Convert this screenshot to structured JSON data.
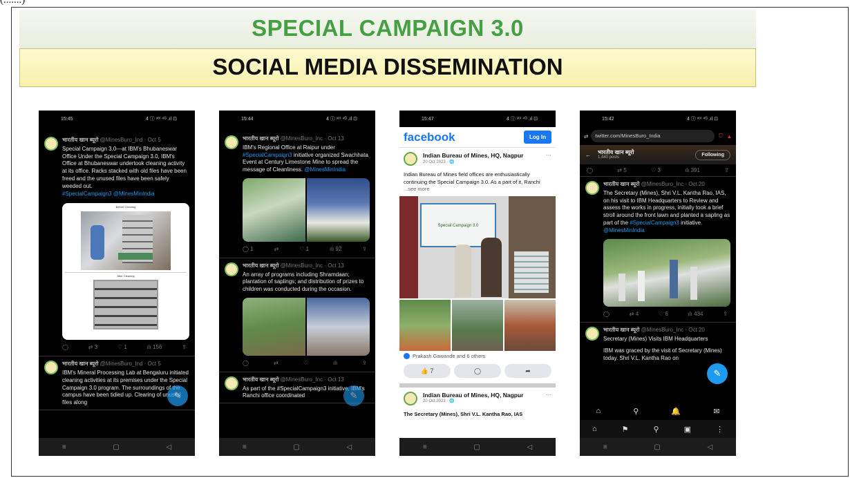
{
  "caption": "(.......)",
  "title": "SPECIAL CAMPAIGN 3.0",
  "subtitle": "SOCIAL MEDIA DISSEMINATION",
  "phone1": {
    "time": "15:45",
    "signal": "4 ⓘ ᵛᵒ⁾ ⁴ᴳ .ıl ⊡",
    "tweet1": {
      "author": "भारतीय खान ब्यूरो",
      "meta": "@MinesBuro_Ind · Oct 5",
      "text": "Special Campaign 3.0—at IBM's Bhubaneswar Office Under the Special Campaign 3.0, IBM's Office at Bhubaneswar undertook cleaning activity at its office. Racks stacked with old files have been freed and the unused files have been safely weeded out.",
      "tags": "#SpecialCampaign3 @MinesMinIndia",
      "img_label_top": "Before Cleaning",
      "img_label_bottom": "After Cleaning",
      "actions": [
        "◯",
        "⇄ 3",
        "♡ 1",
        "ılı 156",
        "⇪"
      ]
    },
    "tweet2": {
      "author": "भारतीय खान ब्यूरो",
      "meta": "@MinesBuro_Ind · Oct 5",
      "text": "IBM's Mineral Processing Lab at Bengaluru initiated cleaning activities at its premises under the Special Campaign 3.0 program. The surroundings of the campus have been tidied up. Clearing of unused files along"
    }
  },
  "phone2": {
    "time": "15:44",
    "tweet1": {
      "author": "भारतीय खान ब्यूरो",
      "meta": "@MinesBuro_Inc · Oct 13",
      "text": "IBM's Regional Office at Raipur under",
      "tag1": "#SpecialCampaign3",
      "text2": "initiative organized Swachhata Event at Century Limestone Mine to spread the message of Cleanliness.",
      "tag2": "@MinesMinIndia",
      "actions": [
        "◯ 1",
        "⇄",
        "♡ 1",
        "ılı 92",
        "⇪"
      ]
    },
    "tweet2": {
      "author": "भारतीय खान ब्यूरो",
      "meta": "@MinesBuro_Inc · Oct 13",
      "text": "An array of programs including Shramdaan; plantation of saplings; and distribution of prizes to children was conducted during the occasion.",
      "actions": [
        "◯",
        "⇄",
        "♡",
        "ılı",
        "⇪"
      ]
    },
    "tweet3": {
      "author": "भारतीय खान ब्यूरो",
      "meta": "@MinesBuro_Inc · Oct 13",
      "text": "As part of the #SpecialCampaign3 initiative, IBM's Ranchi office coordinated"
    }
  },
  "phone3": {
    "time": "15:47",
    "logo": "facebook",
    "login": "Log In",
    "post1": {
      "name": "Indian Bureau of Mines, HQ, Nagpur",
      "date": "20 Oct 2023 · 🌐",
      "text": "Indian Bureau of Mines field offices are enthusiastically continuing the Special Campaign 3.0. As a part of it, Ranchi",
      "more": "...see more",
      "banner": "Special Campaign 3.0",
      "reactions": "Prakash Gawande and 6 others",
      "like_count": "7"
    },
    "post2": {
      "name": "Indian Bureau of Mines, HQ, Nagpur",
      "date": "20 Oct 2023 · 🌐",
      "text": "The Secretary (Mines), Shri V.L. Kantha Rao, IAS"
    }
  },
  "phone4": {
    "time": "15:42",
    "url": "twitter.com/MinesBuro_India",
    "profile_name": "भारतीय खान ब्यूरो",
    "profile_sub": "1,440 posts",
    "following": "Following",
    "tweet1": {
      "author": "भारतीय खान ब्यूरो",
      "meta": "@MinesBuro_Inc · Oct 20",
      "text": "The Secretary (Mines), Shri V.L. Kantha Rao, IAS, on his visit to IBM Headquarters to Review and assess the works in progress, initially took a brief stroll around the front lawn and planted a sapling as part of the",
      "tag1": "#SpecialCampaign3",
      "text2": "initiative.",
      "tag2": "@MinesMinIndia",
      "actions": [
        "◯",
        "⇄ 4",
        "♡ 6",
        "ılı 434",
        "⇪"
      ]
    },
    "tweet2": {
      "author": "भारतीय खान ब्यूरो",
      "meta": "@MinesBuro_Inc · Oct 20",
      "text": "Secretary (Mines) Visits IBM Headquarters",
      "text2": "IBM was graced by the visit of Secretary (Mines) today. Shri V.L. Kantha Rao on"
    }
  },
  "colors": {
    "title_green": "#45a043",
    "twitter_blue": "#1d9bf0",
    "facebook_blue": "#1877f2"
  }
}
